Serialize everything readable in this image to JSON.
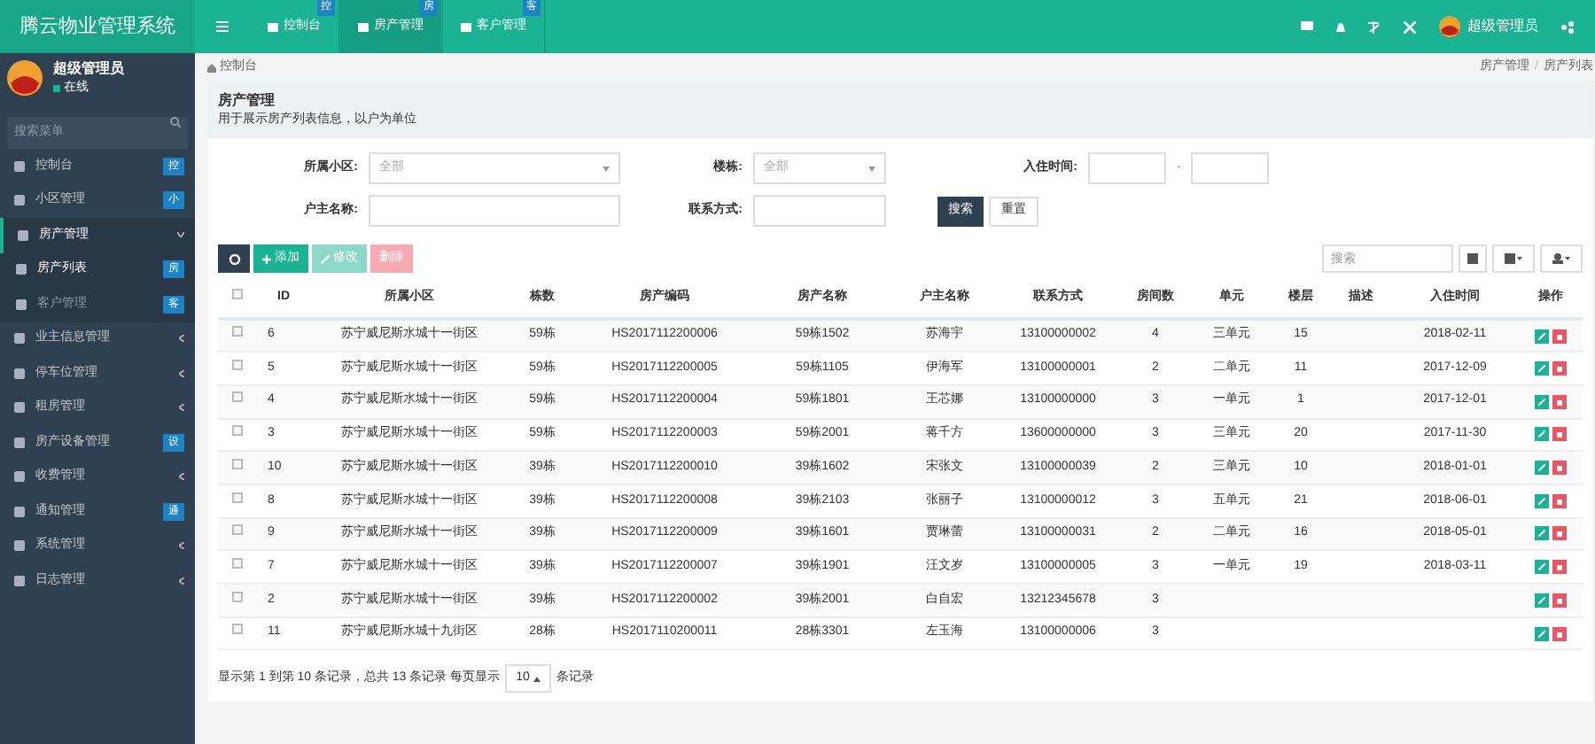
{
  "brand": "腾云物业管理系统",
  "top_tabs": [
    {
      "label": "控制台",
      "badge": "控",
      "selected": false
    },
    {
      "label": "房产管理",
      "badge": "房",
      "selected": true
    },
    {
      "label": "客户管理",
      "badge": "客",
      "selected": false
    }
  ],
  "top_user": "超级管理员",
  "user": {
    "name": "超级管理员",
    "status": "在线"
  },
  "sidebar": {
    "search_placeholder": "搜索菜单",
    "items": [
      {
        "label": "控制台",
        "badge": "控"
      },
      {
        "label": "小区管理",
        "badge": "小"
      },
      {
        "label": "房产管理",
        "expanded": true,
        "children": [
          {
            "label": "房产列表",
            "badge": "房",
            "selected": true
          },
          {
            "label": "客户管理",
            "badge": "客",
            "selected": false
          }
        ]
      },
      {
        "label": "业主信息管理",
        "expanded": false
      },
      {
        "label": "停车位管理",
        "expanded": false
      },
      {
        "label": "租房管理",
        "expanded": false
      },
      {
        "label": "房产设备管理",
        "badge": "设"
      },
      {
        "label": "收费管理",
        "expanded": false
      },
      {
        "label": "通知管理",
        "badge": "通"
      },
      {
        "label": "系统管理",
        "expanded": false
      },
      {
        "label": "日志管理",
        "expanded": false
      }
    ]
  },
  "breadcrumb": {
    "home": "控制台",
    "path": [
      "房产管理",
      "房产列表"
    ],
    "separator": "/"
  },
  "select_all_checked": false,
  "rows_checked": [
    false,
    false,
    false,
    false,
    false,
    false,
    false,
    false,
    false,
    false
  ],
  "panel": {
    "title": "房产管理",
    "subtitle": "用于展示房产列表信息，以户为单位"
  },
  "filters": [
    {
      "label": "所属小区:",
      "kind": "select",
      "value": "全部"
    },
    {
      "label": "楼栋:",
      "kind": "select",
      "value": "全部"
    },
    {
      "label": "入住时间:",
      "kind": "range",
      "separator": "-"
    },
    {
      "label": "户主名称:",
      "kind": "input"
    },
    {
      "label": "联系方式:",
      "kind": "input"
    }
  ],
  "filter_buttons": [
    "搜索",
    "重置"
  ],
  "toolbar": [
    {
      "label": "添加",
      "disabled": false
    },
    {
      "label": "修改",
      "disabled": true
    },
    {
      "label": "删除",
      "disabled": true
    }
  ],
  "table_search": {
    "placeholder": "搜索"
  },
  "table": {
    "columns": [
      "ID",
      "所属小区",
      "栋数",
      "房产编码",
      "房产名称",
      "户主名称",
      "联系方式",
      "房间数",
      "单元",
      "楼层",
      "描述",
      "入住时间",
      "操作"
    ],
    "rows": [
      [
        "6",
        "苏宁威尼斯水城十一街区",
        "59栋",
        "HS2017112200006",
        "59栋1502",
        "苏海宇",
        "13100000002",
        "4",
        "三单元",
        "15",
        "",
        "2018-02-11"
      ],
      [
        "5",
        "苏宁威尼斯水城十一街区",
        "59栋",
        "HS2017112200005",
        "59栋1105",
        "伊海军",
        "13100000001",
        "2",
        "二单元",
        "11",
        "",
        "2017-12-09"
      ],
      [
        "4",
        "苏宁威尼斯水城十一街区",
        "59栋",
        "HS2017112200004",
        "59栋1801",
        "王芯娜",
        "13100000000",
        "3",
        "一单元",
        "1",
        "",
        "2017-12-01"
      ],
      [
        "3",
        "苏宁威尼斯水城十一街区",
        "59栋",
        "HS2017112200003",
        "59栋2001",
        "蒋千方",
        "13600000000",
        "3",
        "三单元",
        "20",
        "",
        "2017-11-30"
      ],
      [
        "10",
        "苏宁威尼斯水城十一街区",
        "39栋",
        "HS2017112200010",
        "39栋1602",
        "宋张文",
        "13100000039",
        "2",
        "三单元",
        "10",
        "",
        "2018-01-01"
      ],
      [
        "8",
        "苏宁威尼斯水城十一街区",
        "39栋",
        "HS2017112200008",
        "39栋2103",
        "张丽子",
        "13100000012",
        "3",
        "五单元",
        "21",
        "",
        "2018-06-01"
      ],
      [
        "9",
        "苏宁威尼斯水城十一街区",
        "39栋",
        "HS2017112200009",
        "39栋1601",
        "贾琳蕾",
        "13100000031",
        "2",
        "二单元",
        "16",
        "",
        "2018-05-01"
      ],
      [
        "7",
        "苏宁威尼斯水城十一街区",
        "39栋",
        "HS2017112200007",
        "39栋1901",
        "汪文岁",
        "13100000005",
        "3",
        "一单元",
        "19",
        "",
        "2018-03-11"
      ],
      [
        "2",
        "苏宁威尼斯水城十一街区",
        "39栋",
        "HS2017112200002",
        "39栋2001",
        "白自宏",
        "13212345678",
        "3",
        "",
        "",
        "",
        ""
      ],
      [
        "11",
        "苏宁威尼斯水城十九街区",
        "28栋",
        "HS2017110200011",
        "28栋3301",
        "左玉海",
        "13100000006",
        "3",
        "",
        "",
        "",
        ""
      ]
    ]
  },
  "pagination": {
    "info": "显示第 1 到第 10 条记录，总共 13 条记录 每页显示",
    "page_size": "10",
    "suffix": "条记录"
  }
}
